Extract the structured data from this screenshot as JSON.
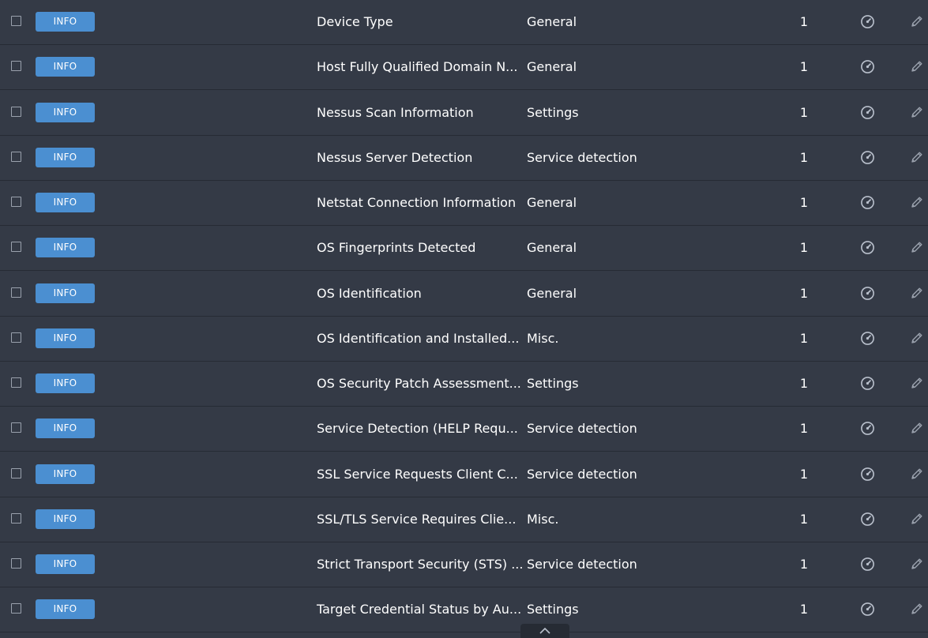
{
  "rows": [
    {
      "severity": "INFO",
      "name": "Device Type",
      "family": "General",
      "count": "1"
    },
    {
      "severity": "INFO",
      "name": "Host Fully Qualified Domain N...",
      "family": "General",
      "count": "1"
    },
    {
      "severity": "INFO",
      "name": "Nessus Scan Information",
      "family": "Settings",
      "count": "1"
    },
    {
      "severity": "INFO",
      "name": "Nessus Server Detection",
      "family": "Service detection",
      "count": "1"
    },
    {
      "severity": "INFO",
      "name": "Netstat Connection Information",
      "family": "General",
      "count": "1"
    },
    {
      "severity": "INFO",
      "name": "OS Fingerprints Detected",
      "family": "General",
      "count": "1"
    },
    {
      "severity": "INFO",
      "name": "OS Identification",
      "family": "General",
      "count": "1"
    },
    {
      "severity": "INFO",
      "name": "OS Identification and Installed...",
      "family": "Misc.",
      "count": "1"
    },
    {
      "severity": "INFO",
      "name": "OS Security Patch Assessment...",
      "family": "Settings",
      "count": "1"
    },
    {
      "severity": "INFO",
      "name": "Service Detection (HELP Requ...",
      "family": "Service detection",
      "count": "1"
    },
    {
      "severity": "INFO",
      "name": "SSL Service Requests Client C...",
      "family": "Service detection",
      "count": "1"
    },
    {
      "severity": "INFO",
      "name": "SSL/TLS Service Requires Clie...",
      "family": "Misc.",
      "count": "1"
    },
    {
      "severity": "INFO",
      "name": "Strict Transport Security (STS) ...",
      "family": "Service detection",
      "count": "1"
    },
    {
      "severity": "INFO",
      "name": "Target Credential Status by Au...",
      "family": "Settings",
      "count": "1"
    }
  ],
  "icons": {
    "checkbox": "checkbox-icon",
    "severity_badge": "info-badge",
    "live_results": "gauge-icon",
    "edit": "pencil-icon",
    "scroll_top": "chevron-up-icon"
  },
  "colors": {
    "background": "#343a46",
    "row_divider": "#262b34",
    "info_badge": "#4b8fd1",
    "icon": "#b9c0cc"
  }
}
